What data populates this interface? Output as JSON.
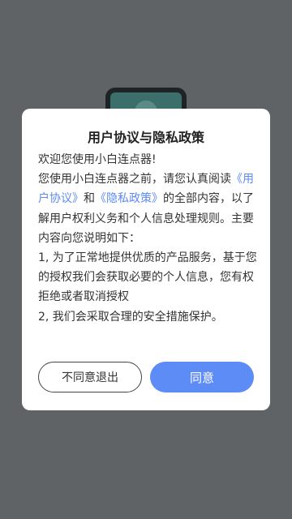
{
  "background_icon": {
    "name": "app-icon"
  },
  "dialog": {
    "title": "用户协议与隐私政策",
    "welcome": "欢迎您使用小白连点器!",
    "intro_before": "您使用小白连点器之前，请您认真阅读",
    "user_agreement_link": "《用户协议》",
    "intro_and": "和",
    "privacy_link": "《隐私政策》",
    "intro_after": "的全部内容，以了解用户权利义务和个人信息处理规则。主要内容向您说明如下：",
    "point1": "1, 为了正常地提供优质的产品服务，基于您的授权我们会获取必要的个人信息，您有权拒绝或者取消授权",
    "point2": "2, 我们会采取合理的安全措施保护。",
    "decline_label": "不同意退出",
    "agree_label": "同意"
  },
  "colors": {
    "overlay": "#5f6366",
    "link": "#5d8bf0",
    "primary_button": "#5d8cf7"
  }
}
